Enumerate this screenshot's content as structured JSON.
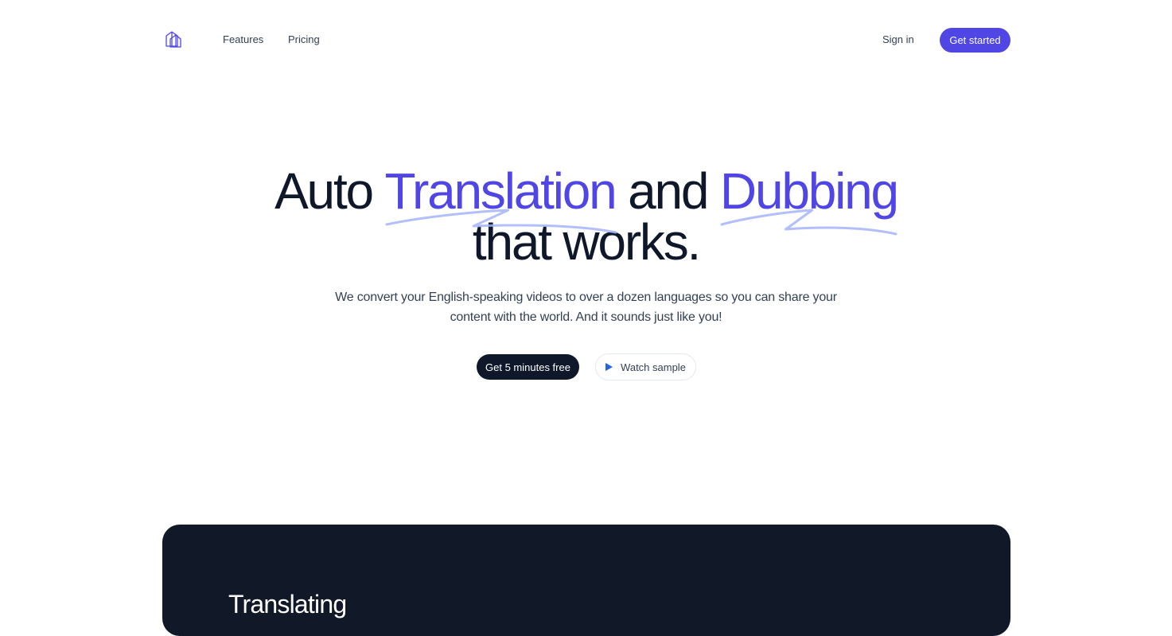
{
  "brand": {
    "logo_icon": "building-blocks-icon",
    "accent_color": "#4f46e5",
    "dark_color": "#0f172a"
  },
  "nav": {
    "links": [
      "Features",
      "Pricing"
    ],
    "sign_in": "Sign in",
    "get_started": "Get started"
  },
  "hero": {
    "title_part1": "Auto",
    "title_highlight1": "Translation",
    "title_part2": "and",
    "title_highlight2": "Dubbing",
    "title_line2": "that works.",
    "subtitle_line1": "We convert your English-speaking videos to over a dozen languages so you can share your",
    "subtitle_line2": "content with the world. And it sounds just like you!",
    "cta_primary": "Get 5 minutes free",
    "cta_secondary": "Watch sample",
    "cta_secondary_icon": "play-icon"
  },
  "panel": {
    "heading": "Translating"
  }
}
